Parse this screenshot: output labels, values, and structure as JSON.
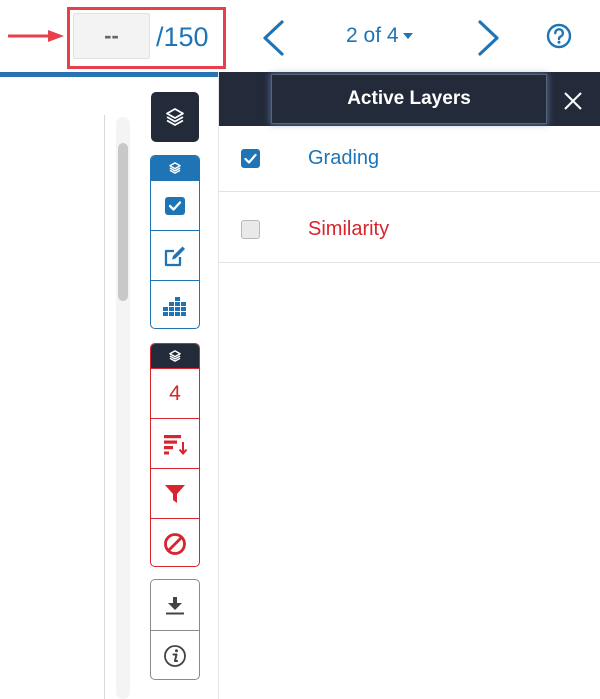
{
  "header": {
    "grade_input": {
      "value": "--"
    },
    "grade_max": "/150",
    "page_selector": "2 of 4"
  },
  "toolbar": {
    "grading_group": {
      "icons": [
        "layers-icon",
        "checkbox-icon",
        "edit-icon",
        "grid-icon"
      ]
    },
    "similarity_group": {
      "count": "4",
      "icons": [
        "layers-icon",
        "sort-icon",
        "filter-icon",
        "exclude-icon"
      ]
    },
    "utility_group": {
      "icons": [
        "download-icon",
        "info-icon"
      ]
    }
  },
  "panel": {
    "title": "Active Layers",
    "layers": [
      {
        "label": "Grading",
        "checked": true,
        "color": "#1f74b5"
      },
      {
        "label": "Similarity",
        "checked": false,
        "color": "#d6252c"
      }
    ]
  },
  "colors": {
    "accent_blue": "#1f74b5",
    "similarity_red": "#d6252c",
    "dark_navy": "#232b3b",
    "highlight_red": "#e8404a"
  }
}
